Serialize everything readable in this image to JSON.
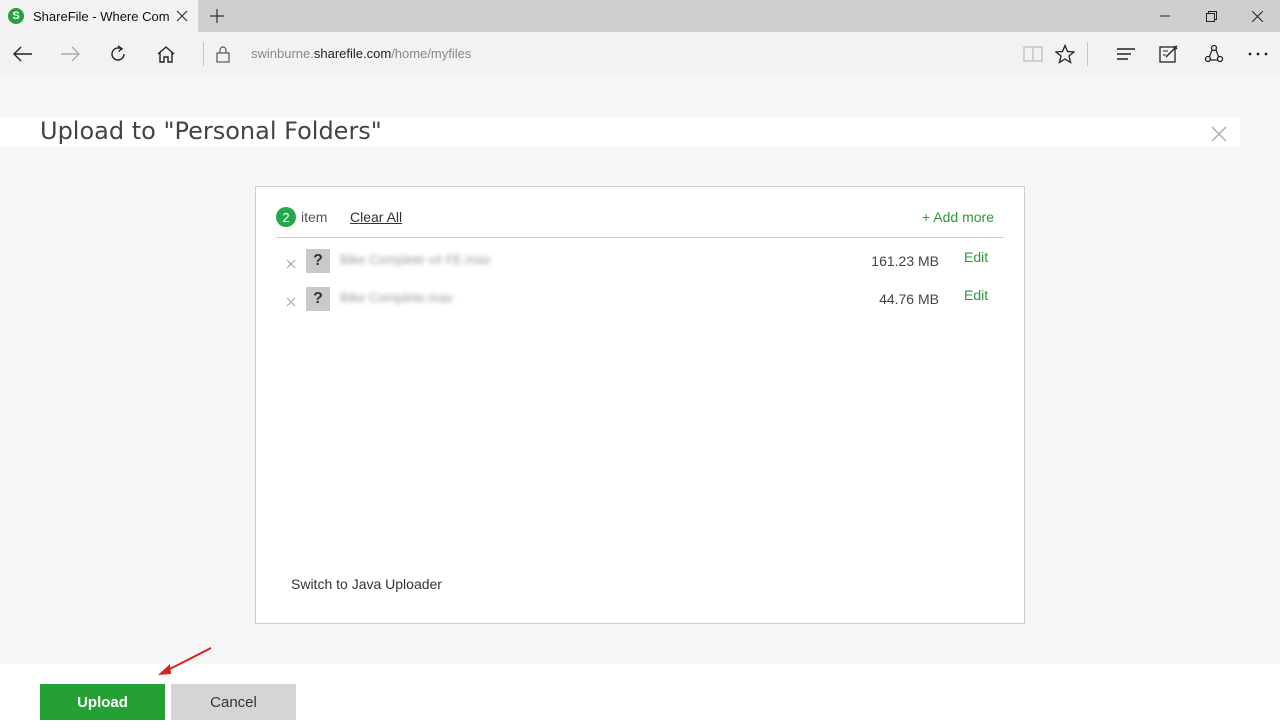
{
  "browser": {
    "tab_title": "ShareFile - Where Comp",
    "favicon_letter": "S",
    "url_prefix": "swinburne.",
    "url_host": "sharefile.com",
    "url_path": "/home/myfiles"
  },
  "dialog": {
    "title": "Upload to \"Personal Folders\""
  },
  "panel": {
    "count": "2",
    "count_label": "item",
    "clear_all": "Clear All",
    "add_more": "+ Add more",
    "files": [
      {
        "name": "Bike Complete v4 FE.max",
        "size": "161.23 MB",
        "edit": "Edit",
        "type_glyph": "?"
      },
      {
        "name": "Bike Complete.max",
        "size": "44.76 MB",
        "edit": "Edit",
        "type_glyph": "?"
      }
    ],
    "java_link": "Switch to Java Uploader"
  },
  "footer": {
    "upload": "Upload",
    "cancel": "Cancel"
  },
  "colors": {
    "brand_green": "#24a034",
    "link_green": "#2d9a3a",
    "annotation_arrow": "#d9221c"
  }
}
